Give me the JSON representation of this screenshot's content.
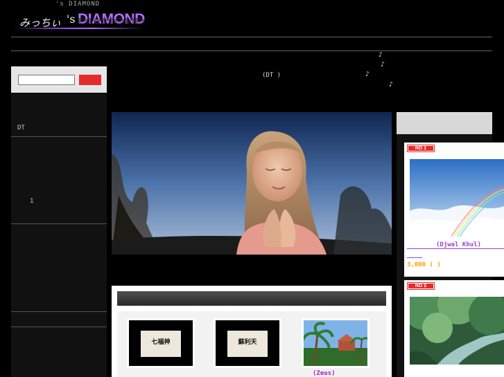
{
  "header": {
    "top_tag": "'s DIAMOND",
    "logo_jp": "みっちぃ",
    "logo_s": "'s",
    "logo_main": "DIAMOND",
    "tagline_dt": "(DT    )",
    "notes": [
      "♪",
      "♪",
      "♪",
      "♪"
    ]
  },
  "search": {
    "placeholder": ""
  },
  "sidebar": {
    "items": [
      {
        "label": "DT"
      },
      {
        "label": "1"
      }
    ]
  },
  "hero": {
    "image": "praying-girl-photo"
  },
  "panel": {
    "cards": [
      {
        "label": "七福神"
      },
      {
        "label": "蘇利天"
      }
    ],
    "zeus_label": "(Zeus)"
  },
  "ranking": [
    {
      "badge": "NO 1",
      "title": "(Djwal Khul)",
      "price": "3,000 (  )"
    },
    {
      "badge": "NO 2",
      "title": "",
      "price": ""
    }
  ],
  "colors": {
    "accent_purple": "#b66cff",
    "search_red": "#e52b2b",
    "price_orange": "#ff9a00"
  }
}
